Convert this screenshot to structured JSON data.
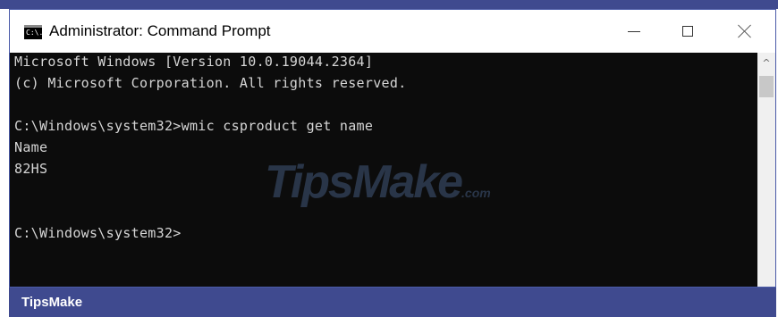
{
  "window": {
    "title": "Administrator: Command Prompt",
    "icon": "cmd-icon",
    "icon_text": "C:\\."
  },
  "console": {
    "lines": [
      "Microsoft Windows [Version 10.0.19044.2364]",
      "(c) Microsoft Corporation. All rights reserved.",
      "",
      "C:\\Windows\\system32>wmic csproduct get name",
      "Name",
      "82HS",
      "",
      "",
      "C:\\Windows\\system32>"
    ]
  },
  "watermark": {
    "main": "TipsMake",
    "suffix": ".com"
  },
  "footer": {
    "brand": "TipsMake"
  },
  "colors": {
    "console_bg": "#0c0c0c",
    "console_text": "#d6d6d6",
    "footer_bg": "#3f4a8f"
  }
}
